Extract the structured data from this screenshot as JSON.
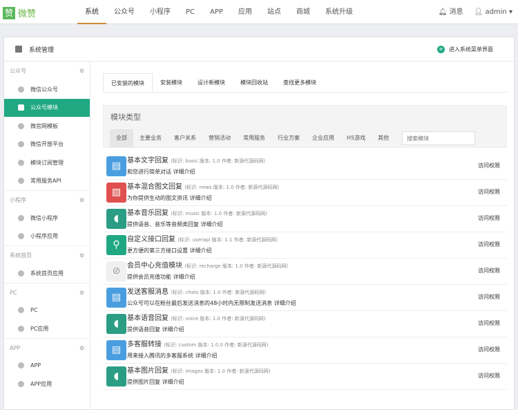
{
  "logo": {
    "text": "微赞",
    "mark": "赞"
  },
  "nav": [
    "系统",
    "公众号",
    "小程序",
    "PC",
    "APP",
    "应用",
    "站点",
    "商城",
    "系统升级"
  ],
  "top_right": {
    "messages": "消息",
    "user": "admin"
  },
  "panel": {
    "title": "系统管理",
    "enter": "进入系统菜单界面"
  },
  "sidebar": [
    {
      "title": "公众号",
      "items": [
        "微信公众号",
        "公众号模块",
        "微官网模板",
        "微信开放平台",
        "模块订阅管理",
        "常用服务API"
      ]
    },
    {
      "title": "小程序",
      "items": [
        "微信小程序",
        "小程序应用"
      ]
    },
    {
      "title": "系统首页",
      "items": [
        "系统首页应用"
      ]
    },
    {
      "title": "PC",
      "items": [
        "PC",
        "PC应用"
      ]
    },
    {
      "title": "APP",
      "items": [
        "APP",
        "APP应用"
      ]
    }
  ],
  "active_item": "公众号模块",
  "tabs": [
    "已安装的模块",
    "安装模块",
    "设计新模块",
    "模块回收站",
    "查找更多模块"
  ],
  "module_type": {
    "title": "模块类型",
    "cats": [
      "全部",
      "主要业务",
      "客户关系",
      "营销活动",
      "常用服务",
      "行业方案",
      "企业应用",
      "H5游戏",
      "其他"
    ],
    "search_placeholder": "搜索模块"
  },
  "access_label": "访问权限",
  "colors": {
    "accent": "#20a883",
    "blue": "#4a9ee0",
    "red": "#e05050",
    "teal": "#2a9d84"
  },
  "modules": [
    {
      "name": "基本文字回复",
      "meta": "(标识: basic  版本: 1.0  作者: 新源代源码网)",
      "desc": "和您进行简单对话 详细介绍",
      "icon": "book",
      "color": "#4a9ee0"
    },
    {
      "name": "基本混合图文回复",
      "meta": "(标识: news  版本: 1.0  作者: 新源代源码网)",
      "desc": "为你提供生动的图文资讯 详细介绍",
      "icon": "image",
      "color": "#e05050"
    },
    {
      "name": "基本音乐回复",
      "meta": "(标识: music  版本: 1.0  作者: 新源代源码网)",
      "desc": "提供语音、音乐等音频类回复 详细介绍",
      "icon": "speaker",
      "color": "#2a9d84"
    },
    {
      "name": "自定义接口回复",
      "meta": "(标识: userapi  版本: 1.1  作者: 新源代源码网)",
      "desc": "更方便的第三方接口设置 详细介绍",
      "icon": "tree",
      "color": "#20a883"
    },
    {
      "name": "会员中心充值模块",
      "meta": "(标识: recharge  版本: 1.0  作者: 新源代源码网)",
      "desc": "提供会员充值功能 详细介绍",
      "icon": "no-image",
      "color": "#f0f0f0"
    },
    {
      "name": "发送客服消息",
      "meta": "(标识: chats  版本: 1.0  作者: 新源代源码网)",
      "desc": "公众号可以在粉丝最后发送消息的48小时内无限制发送消息 详细介绍",
      "icon": "book",
      "color": "#4a9ee0"
    },
    {
      "name": "基本语音回复",
      "meta": "(标识: voice  版本: 1.0  作者: 新源代源码网)",
      "desc": "提供语音回复 详细介绍",
      "icon": "speaker",
      "color": "#2a9d84"
    },
    {
      "name": "多客服转接",
      "meta": "(标识: custom  版本: 1.0.0  作者: 新源代源码网)",
      "desc": "用来接入腾讯的多客服系统 详细介绍",
      "icon": "book",
      "color": "#4a9ee0"
    },
    {
      "name": "基本图片回复",
      "meta": "(标识: images  版本: 1.0  作者: 新源代源码网)",
      "desc": "提供图片回复 详细介绍",
      "icon": "speaker",
      "color": "#2a9d84"
    }
  ]
}
